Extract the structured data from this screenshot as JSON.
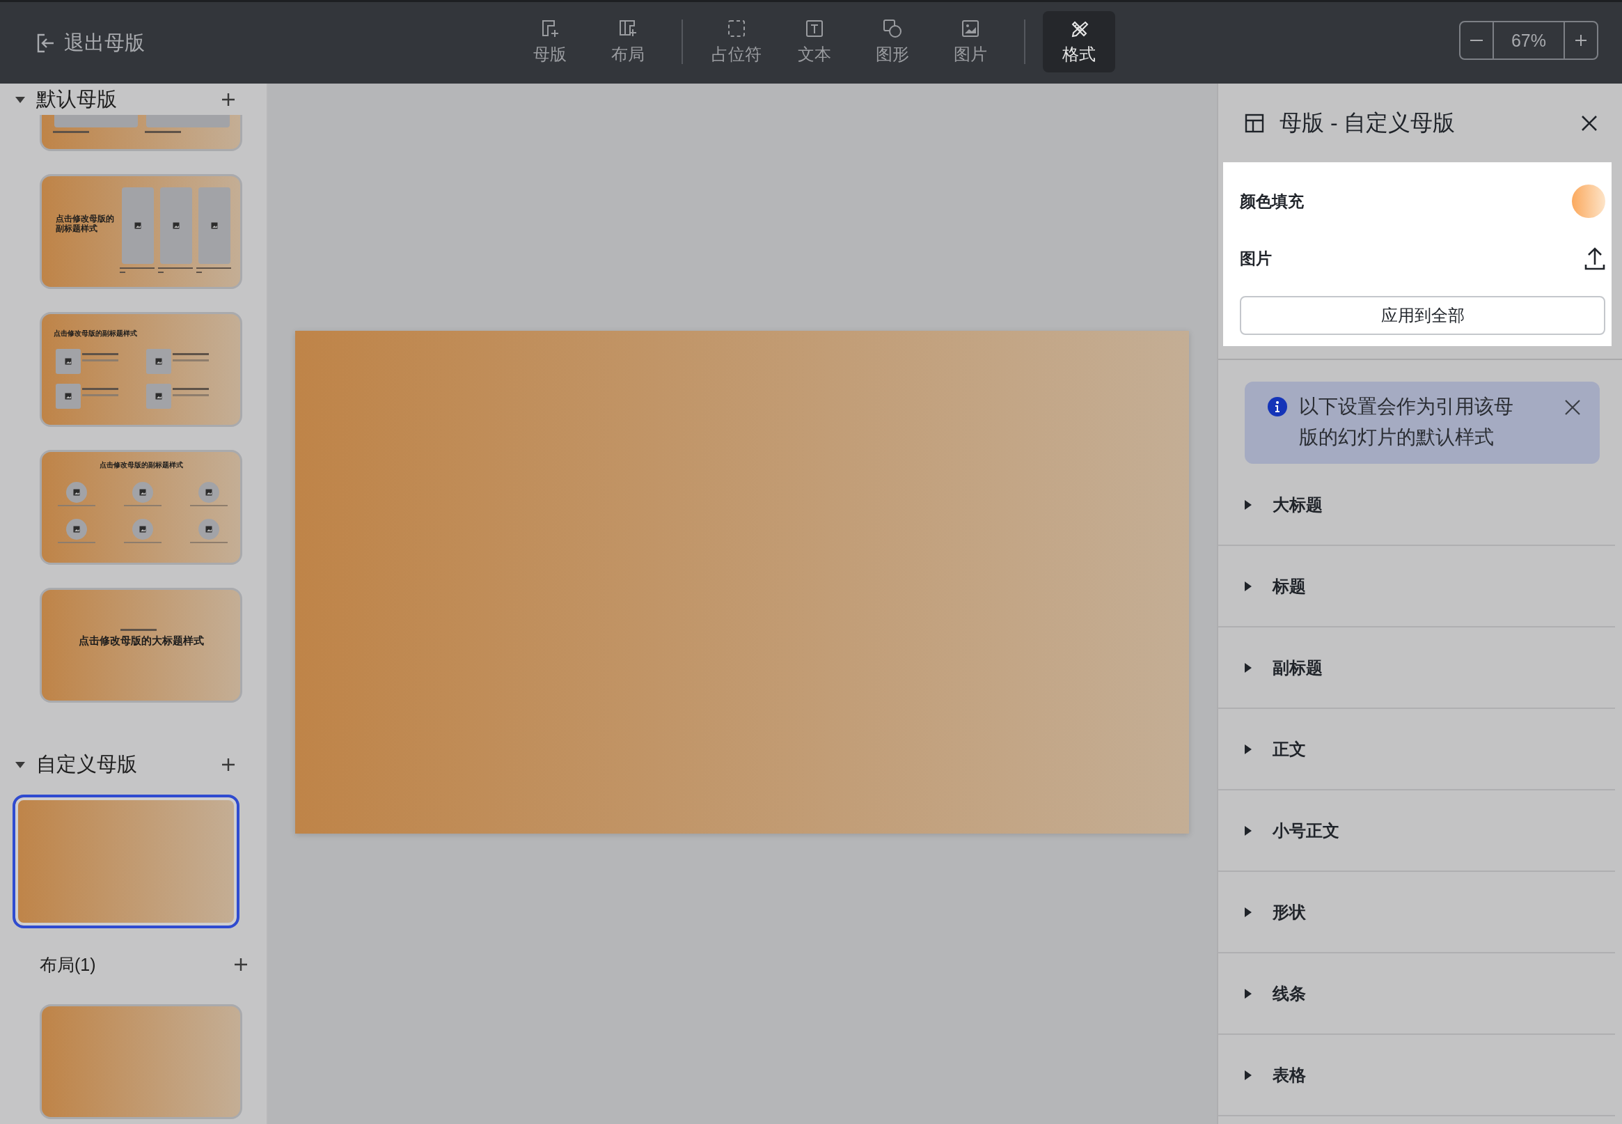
{
  "top_bar": {
    "exit_label": "退出母版",
    "tool_groups": [
      [
        {
          "label": "母版",
          "selected": false
        },
        {
          "label": "布局",
          "selected": false
        }
      ],
      [
        {
          "label": "占位符",
          "selected": false
        },
        {
          "label": "文本",
          "selected": false
        },
        {
          "label": "图形",
          "selected": false
        },
        {
          "label": "图片",
          "selected": false
        }
      ],
      [
        {
          "label": "格式",
          "selected": true
        }
      ]
    ],
    "zoom": {
      "value": "67%"
    }
  },
  "sidebar": {
    "sections": [
      {
        "title": "默认母版",
        "expanded": true,
        "thumbnails": [
          {
            "kind": "two-images",
            "selected": false
          },
          {
            "kind": "three-columns",
            "title": "点击修改母版的副标题样式",
            "selected": false
          },
          {
            "kind": "four-items",
            "title": "点击修改母版的副标题样式",
            "selected": false
          },
          {
            "kind": "six-circles",
            "title": "点击修改母版的副标题样式",
            "selected": false
          },
          {
            "kind": "title",
            "title": "点击修改母版的大标题样式",
            "selected": false
          }
        ]
      },
      {
        "title": "自定义母版",
        "expanded": true,
        "thumbnails": [
          {
            "kind": "blank",
            "selected": true
          }
        ],
        "layouts": {
          "label": "布局(1)",
          "thumbnails": [
            {
              "kind": "blank",
              "selected": false
            }
          ]
        }
      }
    ]
  },
  "panel": {
    "title": "母版 - 自定义母版",
    "fill_label": "颜色填充",
    "image_label": "图片",
    "apply_button": "应用到全部",
    "notice": "以下设置会作为引用该母版的幻灯片的默认样式",
    "style_sections": [
      {
        "label": "大标题",
        "expanded": false
      },
      {
        "label": "标题",
        "expanded": false
      },
      {
        "label": "副标题",
        "expanded": false
      },
      {
        "label": "正文",
        "expanded": false
      },
      {
        "label": "小号正文",
        "expanded": false
      },
      {
        "label": "形状",
        "expanded": false
      },
      {
        "label": "线条",
        "expanded": false
      },
      {
        "label": "表格",
        "expanded": false
      }
    ]
  }
}
